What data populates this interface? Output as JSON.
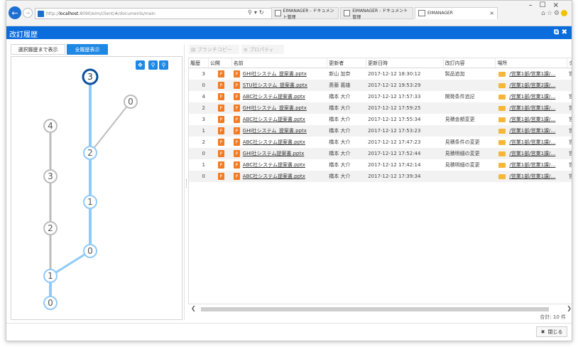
{
  "browser": {
    "url_prefix": "http://",
    "url_host": "localhost",
    "url_rest": ":8090/eim/client/#/documents/main",
    "tabs": [
      {
        "label": "EIMANAGER - ドキュメント管理"
      },
      {
        "label": "EIMANAGER - ドキュメント管理"
      },
      {
        "label": "EIMANAGER"
      }
    ]
  },
  "titlebar": {
    "title": "改訂履歴"
  },
  "left_panel": {
    "btn_selected": "選択履歴まで表示",
    "btn_all": "全履歴表示",
    "nodes": [
      {
        "label": "3",
        "highlight": true
      },
      {
        "label": "0"
      },
      {
        "label": "4"
      },
      {
        "label": "2",
        "highlight": true
      },
      {
        "label": "3"
      },
      {
        "label": "1",
        "highlight": true
      },
      {
        "label": "2"
      },
      {
        "label": "0",
        "highlight": true
      },
      {
        "label": "1",
        "highlight": true
      },
      {
        "label": "0",
        "highlight": true
      }
    ]
  },
  "toolbar": {
    "branch_copy": "ブランチコピー",
    "properties": "プロパティ"
  },
  "table": {
    "headers": [
      "履歴",
      "公開",
      "名前",
      "更新者",
      "更新日時",
      "改訂内容",
      "場所",
      "タ"
    ],
    "rows": [
      {
        "rev": "3",
        "name": "GHI社システム_提案書.pptx",
        "updater": "新山 加奈",
        "date": "2017-12-12 18:30:12",
        "note": "製品追加",
        "location": "/営業1部/営業1課/…",
        "tag": "営"
      },
      {
        "rev": "0",
        "name": "STU社システム_提案書.pptx",
        "updater": "斎藤 義雄",
        "date": "2017-12-12 19:53:29",
        "note": "",
        "location": "/営業1部/営業2課/…",
        "tag": ""
      },
      {
        "rev": "4",
        "name": "ABC社システム提案書.pptx",
        "updater": "橋本 大介",
        "date": "2017-12-12 17:57:33",
        "note": "開発条件追記",
        "location": "/営業1部/営業1課/…",
        "tag": "営"
      },
      {
        "rev": "2",
        "name": "GHI社システム_提案書.pptx",
        "updater": "橋本 大介",
        "date": "2017-12-12 17:59:25",
        "note": "",
        "location": "/営業1部/営業1課/…",
        "tag": "営"
      },
      {
        "rev": "3",
        "name": "ABC社システム提案書.pptx",
        "updater": "橋本 大介",
        "date": "2017-12-12 17:55:34",
        "note": "見積金額変更",
        "location": "/営業1部/営業1課/…",
        "tag": "営"
      },
      {
        "rev": "1",
        "name": "GHI社システム_提案書.pptx",
        "updater": "橋本 大介",
        "date": "2017-12-12 17:53:23",
        "note": "",
        "location": "/営業1部/営業1課/…",
        "tag": "営"
      },
      {
        "rev": "2",
        "name": "ABC社システム提案書.pptx",
        "updater": "橋本 大介",
        "date": "2017-12-12 17:47:23",
        "note": "見積条件の変更",
        "location": "/営業1部/営業1課/…",
        "tag": "営"
      },
      {
        "rev": "0",
        "name": "GHI社システム提案書.pptx",
        "updater": "橋本 大介",
        "date": "2017-12-12 17:52:44",
        "note": "見積明細の変更",
        "location": "/営業1部/営業1課/…",
        "tag": "営"
      },
      {
        "rev": "1",
        "name": "ABC社システム提案書.pptx",
        "updater": "橋本 大介",
        "date": "2017-12-12 17:42:14",
        "note": "見積明細の変更",
        "location": "/営業1部/営業1課/…",
        "tag": "営"
      },
      {
        "rev": "0",
        "name": "ABC社システム提案書.pptx",
        "updater": "橋本 大介",
        "date": "2017-12-12 17:39:34",
        "note": "",
        "location": "/営業1部/営業1課/…",
        "tag": "営"
      }
    ],
    "public_icon": "powerpoint-file-icon"
  },
  "footer": {
    "total": "合計: 10 件",
    "close_label": "閉じる"
  },
  "colors": {
    "accent": "#1e88e5",
    "titlebar": "#0b6ddb",
    "graph_highlight": "#90caf9",
    "graph_gray": "#bdbdbd",
    "ppt_icon": "#f47a20",
    "folder_icon": "#f5b73b"
  }
}
